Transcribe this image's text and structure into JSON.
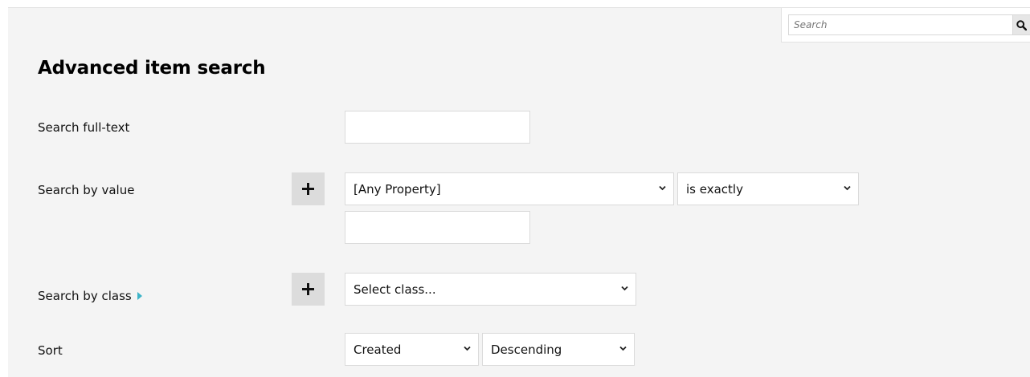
{
  "header": {
    "search": {
      "placeholder": "Search",
      "button_icon": "magnifier-icon"
    }
  },
  "main": {
    "title": "Advanced item search",
    "fulltext": {
      "label": "Search full-text",
      "value": ""
    },
    "by_value": {
      "label": "Search by value",
      "add_icon": "plus-icon",
      "property_select": "[Any Property]",
      "operator_select": "is exactly",
      "value": ""
    },
    "by_class": {
      "label": "Search by class",
      "expand_icon": "caret-right-icon",
      "accent_color": "#3db4c8",
      "add_icon": "plus-icon",
      "class_select": "Select class..."
    },
    "sort": {
      "label": "Sort",
      "sort_by_select": "Created",
      "order_select": "Descending"
    }
  }
}
